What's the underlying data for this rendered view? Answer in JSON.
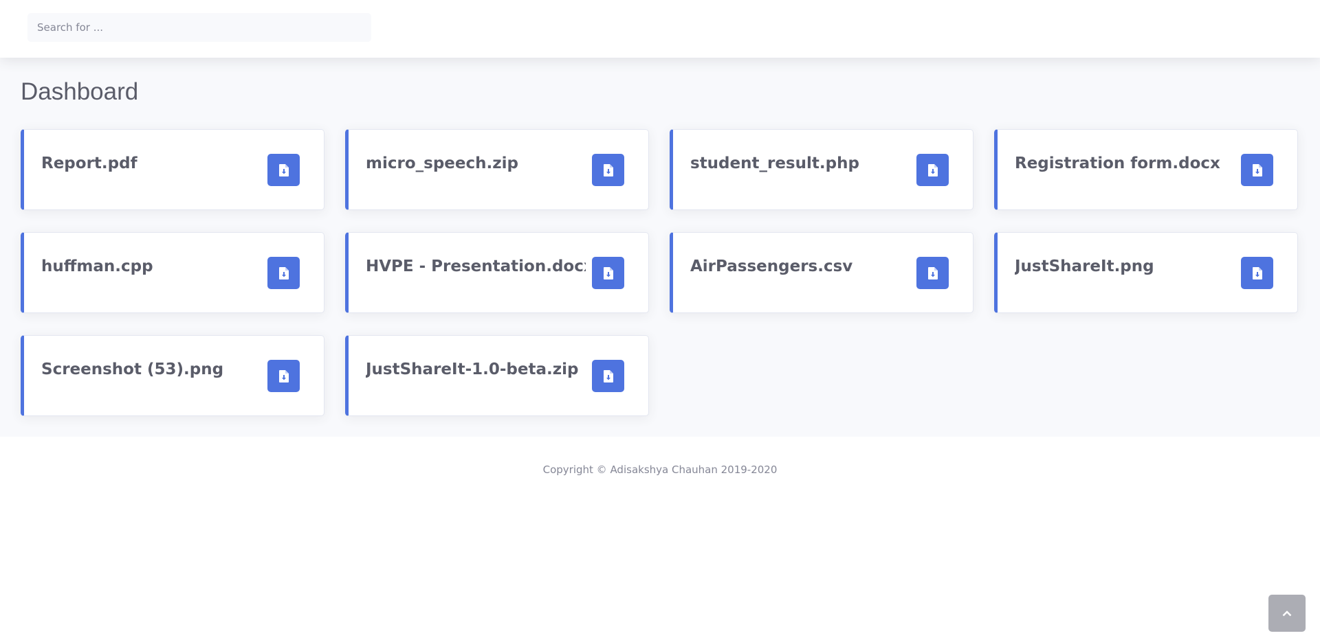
{
  "search": {
    "placeholder": "Search for ..."
  },
  "page": {
    "title": "Dashboard"
  },
  "files": [
    {
      "name": "Report.pdf",
      "icon": "file-download-icon"
    },
    {
      "name": "micro_speech.zip",
      "icon": "file-download-icon"
    },
    {
      "name": "student_result.php",
      "icon": "file-download-icon"
    },
    {
      "name": "Registration form.docx",
      "icon": "file-download-icon"
    },
    {
      "name": "huffman.cpp",
      "icon": "file-download-icon"
    },
    {
      "name": "HVPE - Presentation.docx",
      "icon": "file-download-icon"
    },
    {
      "name": "AirPassengers.csv",
      "icon": "file-download-icon"
    },
    {
      "name": "JustShareIt.png",
      "icon": "file-download-icon"
    },
    {
      "name": "Screenshot (53).png",
      "icon": "file-download-icon"
    },
    {
      "name": "JustShareIt-1.0-beta.zip",
      "icon": "file-download-icon"
    }
  ],
  "footer": {
    "copyright": "Copyright © Adisakshya Chauhan 2019-2020"
  },
  "scroll_top": {
    "icon": "chevron-up-icon"
  },
  "colors": {
    "accent": "#4e73df",
    "text": "#5a5c69",
    "page_bg": "#f8f9fc"
  }
}
